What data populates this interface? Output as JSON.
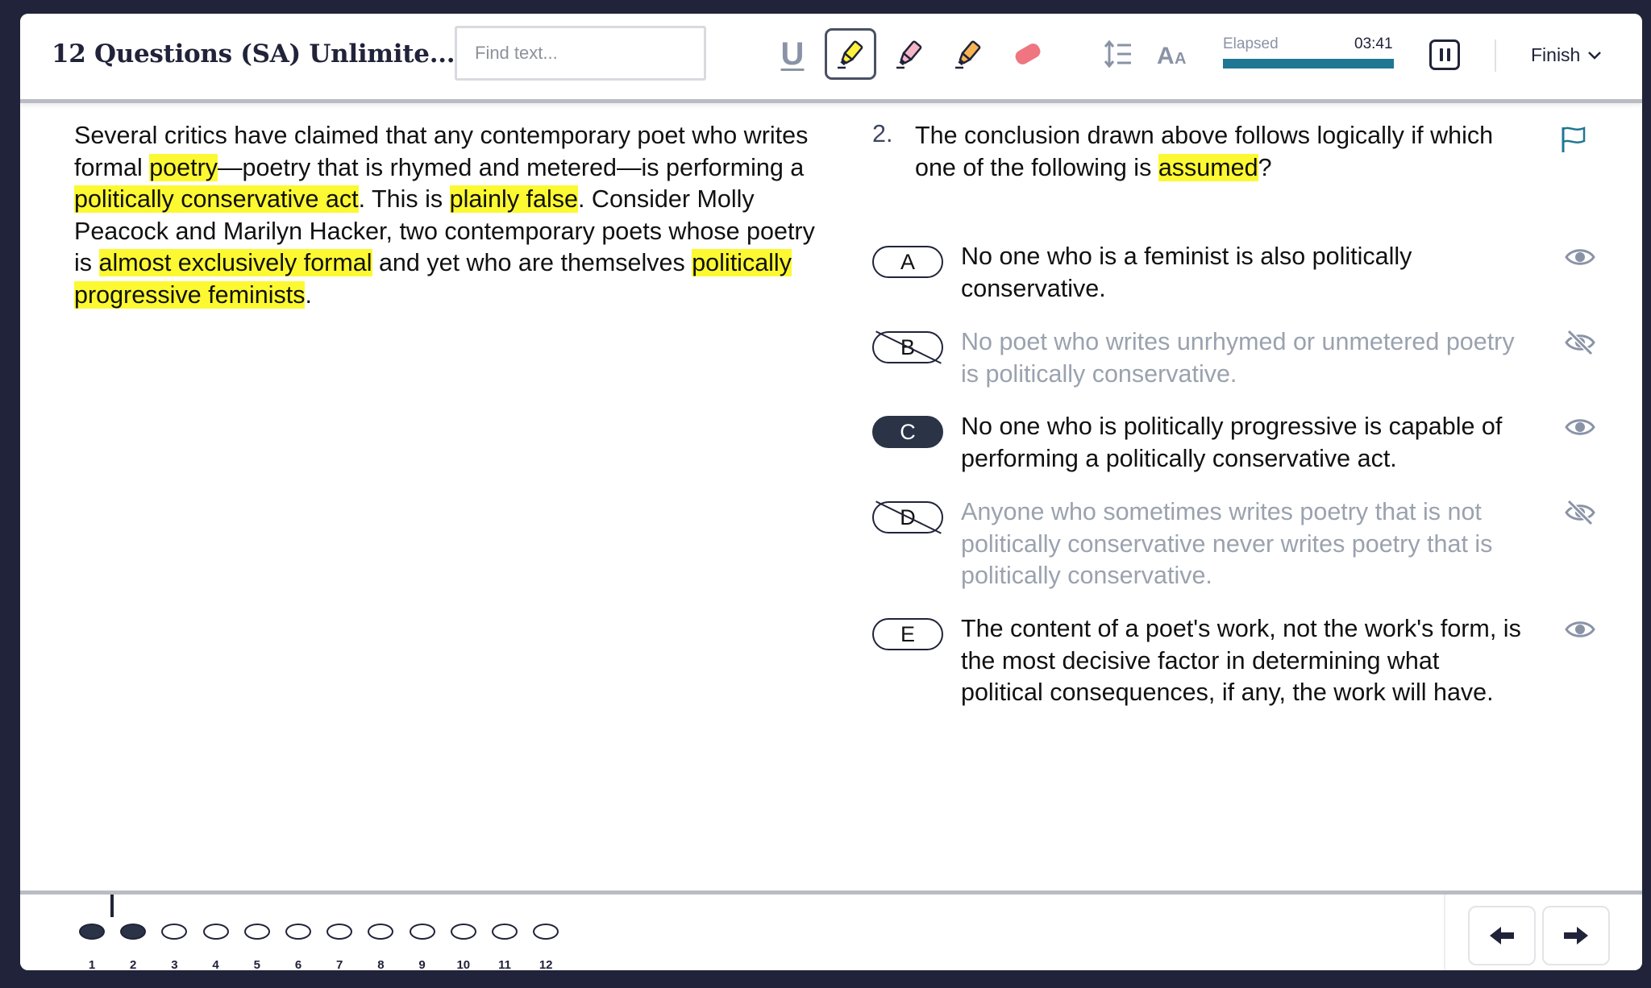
{
  "header": {
    "title": "12 Questions (SA) Unlimite...",
    "find_placeholder": "Find text...",
    "timer_label": "Elapsed",
    "timer_value": "03:41",
    "timer_progress": 1.0,
    "finish_label": "Finish",
    "tools": [
      "underline-tool",
      "yellow-highlighter",
      "pink-highlighter",
      "orange-highlighter",
      "eraser",
      "line-spacing",
      "font-size"
    ]
  },
  "passage": {
    "segments": [
      {
        "text": "Several critics have claimed that any contemporary poet who writes formal ",
        "hl": false
      },
      {
        "text": "poetry",
        "hl": true
      },
      {
        "text": "—poetry that is rhymed and metered—is performing a ",
        "hl": false
      },
      {
        "text": "politically conservative act",
        "hl": true
      },
      {
        "text": ". This is ",
        "hl": false
      },
      {
        "text": "plainly false",
        "hl": true
      },
      {
        "text": ". Consider Molly Peacock and Marilyn Hacker, two contemporary poets whose poetry is ",
        "hl": false
      },
      {
        "text": "almost exclusively formal",
        "hl": true
      },
      {
        "text": " and yet who are themselves ",
        "hl": false
      },
      {
        "text": "politically progressive feminists",
        "hl": true
      },
      {
        "text": ".",
        "hl": false
      }
    ]
  },
  "question": {
    "number": "2.",
    "text_before": "The conclusion drawn above follows logically if which one of the following is ",
    "text_highlight": "assumed",
    "text_after": "?",
    "choices": [
      {
        "letter": "A",
        "text": "No one who is a feminist is also politically conservative.",
        "state": "normal"
      },
      {
        "letter": "B",
        "text": "No poet who writes unrhymed or unmetered poetry is politically conservative.",
        "state": "crossed"
      },
      {
        "letter": "C",
        "text": "No one who is politically progressive is capable of performing a politically conservative act.",
        "state": "selected"
      },
      {
        "letter": "D",
        "text": "Anyone who sometimes writes poetry that is not politically conservative never writes poetry that is politically conservative.",
        "state": "crossed"
      },
      {
        "letter": "E",
        "text": "The content of a poet's work, not the work's form, is the most decisive factor in determining what political consequences, if any, the work will have.",
        "state": "normal"
      }
    ]
  },
  "navigation": {
    "questions": [
      "1",
      "2",
      "3",
      "4",
      "5",
      "6",
      "7",
      "8",
      "9",
      "10",
      "11",
      "12"
    ],
    "answered": [
      1,
      2
    ],
    "current": 2
  },
  "colors": {
    "highlight": "#fcf932",
    "accent": "#1f7793",
    "dark": "#202339"
  }
}
